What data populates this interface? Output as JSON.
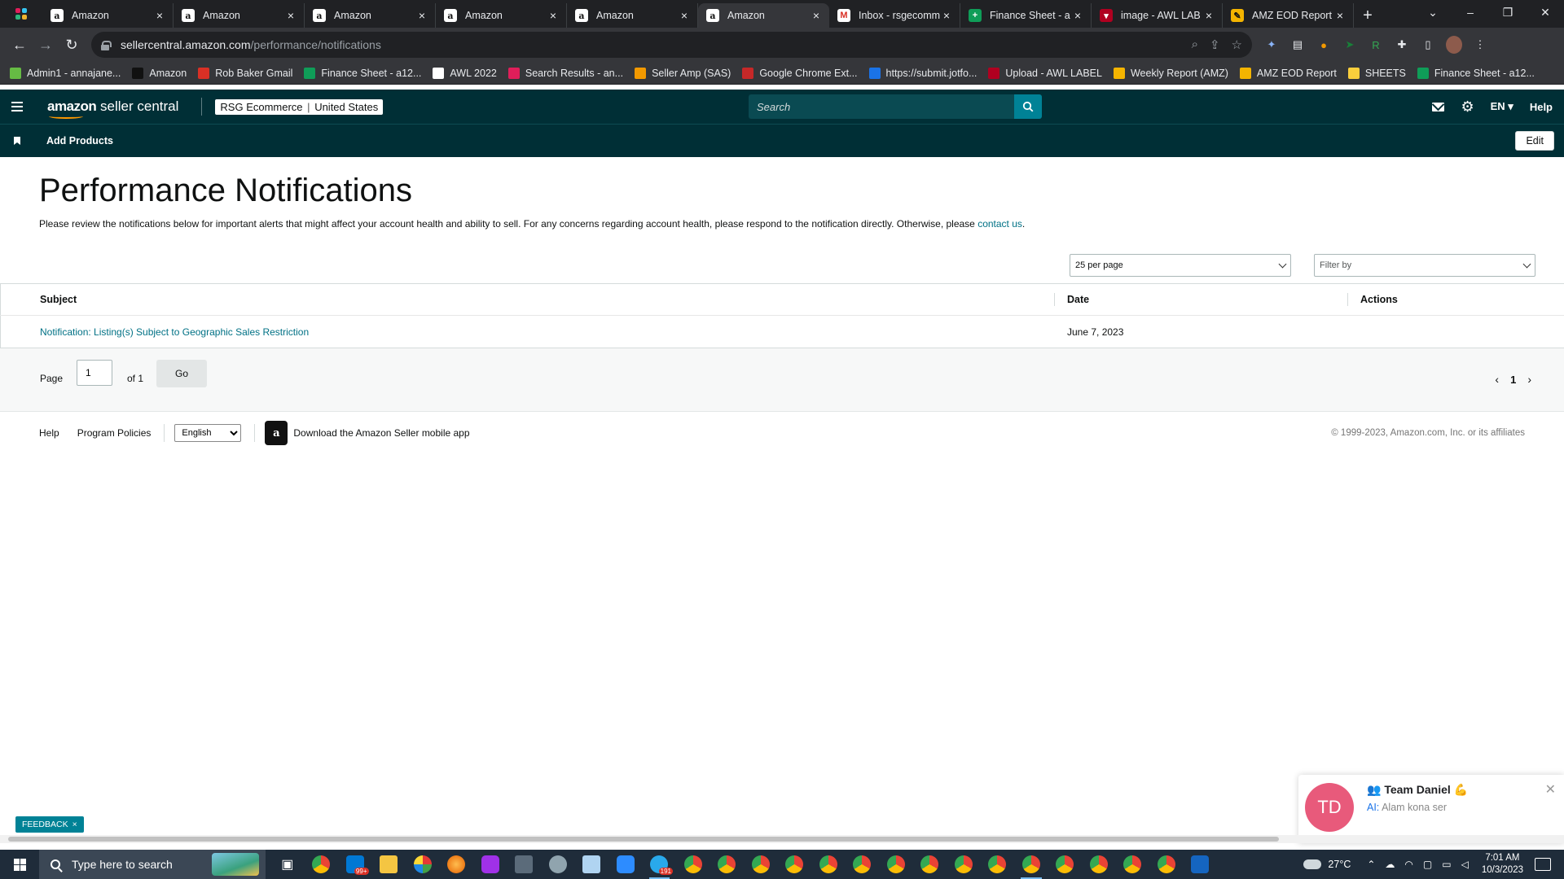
{
  "browser": {
    "tabs": [
      {
        "label": "Amazon",
        "icon": "amazon-icon"
      },
      {
        "label": "Amazon",
        "icon": "amazon-icon"
      },
      {
        "label": "Amazon",
        "icon": "amazon-icon"
      },
      {
        "label": "Amazon",
        "icon": "amazon-icon"
      },
      {
        "label": "Amazon",
        "icon": "amazon-icon"
      },
      {
        "label": "Amazon",
        "icon": "amazon-icon",
        "active": true
      },
      {
        "label": "Inbox - rsgecomm",
        "icon": "gmail-icon"
      },
      {
        "label": "Finance Sheet - a",
        "icon": "sheets-icon"
      },
      {
        "label": "image - AWL LAB",
        "icon": "awl-icon"
      },
      {
        "label": "AMZ EOD Report",
        "icon": "eod-icon"
      }
    ],
    "url_domain": "sellercentral.amazon.com",
    "url_path": "/performance/notifications",
    "bookmarks": [
      {
        "label": "Admin1 - annajane..."
      },
      {
        "label": "Amazon"
      },
      {
        "label": "Rob Baker Gmail"
      },
      {
        "label": "Finance Sheet - a12..."
      },
      {
        "label": "AWL 2022"
      },
      {
        "label": "Search Results - an..."
      },
      {
        "label": "Seller Amp (SAS)"
      },
      {
        "label": "Google Chrome Ext..."
      },
      {
        "label": "https://submit.jotfo..."
      },
      {
        "label": "Upload - AWL LABEL"
      },
      {
        "label": "Weekly Report (AMZ)"
      },
      {
        "label": "AMZ EOD Report"
      },
      {
        "label": "SHEETS"
      },
      {
        "label": "Finance Sheet - a12..."
      }
    ]
  },
  "header": {
    "logo_bold": "amazon",
    "logo_rest": " seller central",
    "store": "RSG Ecommerce",
    "store_sep": "|",
    "marketplace": "United States",
    "search_placeholder": "Search",
    "language": "EN",
    "help": "Help"
  },
  "subnav": {
    "link": "Add Products",
    "edit": "Edit"
  },
  "main": {
    "title": "Performance Notifications",
    "description": "Please review the notifications below for important alerts that might affect your account health and ability to sell. For any concerns regarding account health, please respond to the notification directly. Otherwise, please ",
    "contact_link": "contact us",
    "description_end": ".",
    "per_page": "25 per page",
    "filter_placeholder": "Filter by",
    "columns": {
      "subject": "Subject",
      "date": "Date",
      "actions": "Actions"
    },
    "rows": [
      {
        "subject": "Notification: Listing(s) Subject to Geographic Sales Restriction",
        "date": "June 7, 2023",
        "actions": ""
      }
    ]
  },
  "pagination": {
    "page_label": "Page",
    "page_value": "1",
    "of_label": "of 1",
    "go": "Go",
    "current_page": "1"
  },
  "footer": {
    "help": "Help",
    "policies": "Program Policies",
    "language": "English",
    "app_download": "Download the Amazon Seller mobile app",
    "copyright": "© 1999-2023, Amazon.com, Inc. or its affiliates"
  },
  "feedback": {
    "label": "FEEDBACK"
  },
  "chat": {
    "initials": "TD",
    "name": "Team Daniel 💪",
    "prefix": "AI:",
    "message": "Alam kona ser"
  },
  "taskbar": {
    "search_placeholder": "Type here to search",
    "mail_badge": "99+",
    "telegram_badge": "191",
    "temperature": "27°C",
    "time": "7:01 AM",
    "date": "10/3/2023"
  },
  "colors": {
    "header_bg": "#002f36",
    "link": "#007185",
    "accent": "#008296",
    "chat_avatar": "#e85a7b"
  }
}
